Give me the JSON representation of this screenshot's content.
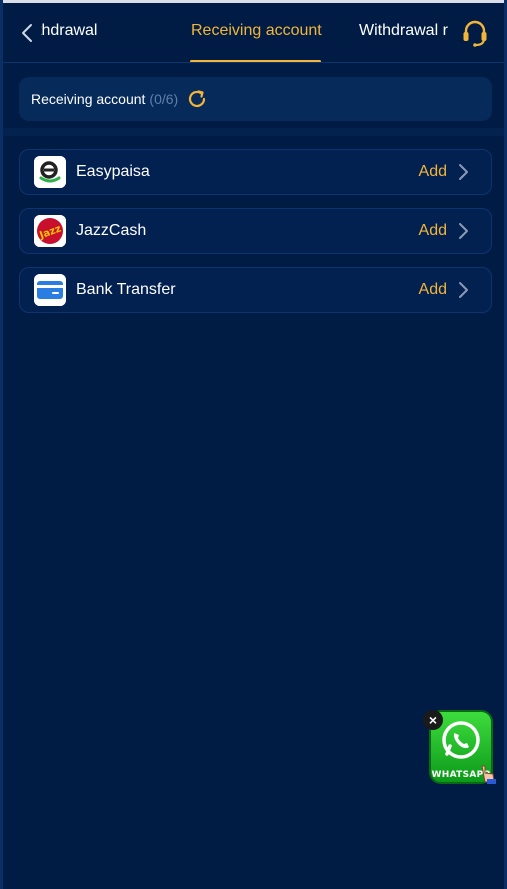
{
  "header": {
    "tabs": [
      {
        "label": "st withdrawal"
      },
      {
        "label": "Receiving account"
      },
      {
        "label": "Withdrawal r"
      }
    ]
  },
  "account": {
    "label": "Receiving account",
    "count": "(0/6)"
  },
  "methods": [
    {
      "name": "Easypaisa",
      "action": "Add"
    },
    {
      "name": "JazzCash",
      "action": "Add"
    },
    {
      "name": "Bank Transfer",
      "action": "Add"
    }
  ],
  "whatsapp": {
    "label": "WHATSAPP",
    "close": "×"
  },
  "colors": {
    "background": "#011c44",
    "accent": "#f2b53a",
    "card": "#062a5a"
  }
}
